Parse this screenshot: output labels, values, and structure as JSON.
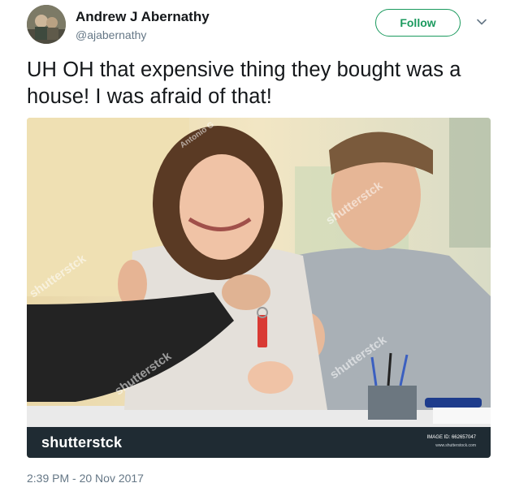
{
  "user": {
    "name": "Andrew J Abernathy",
    "handle": "@ajabernathy"
  },
  "follow_label": "Follow",
  "tweet": {
    "text": "UH OH that expensive thing they bought was a house! I was afraid of that!"
  },
  "media": {
    "watermark_logo": "shutterstck",
    "watermark_text": "shutterstck",
    "image_id": "IMAGE ID: 662657047",
    "site": "www.shutterstock.com",
    "photographer": "Antonio G"
  },
  "timestamp": "2:39 PM - 20 Nov 2017",
  "colors": {
    "follow_green": "#1b9a5e",
    "secondary_text": "#657786",
    "watermark_bar": "#1f2b33"
  }
}
